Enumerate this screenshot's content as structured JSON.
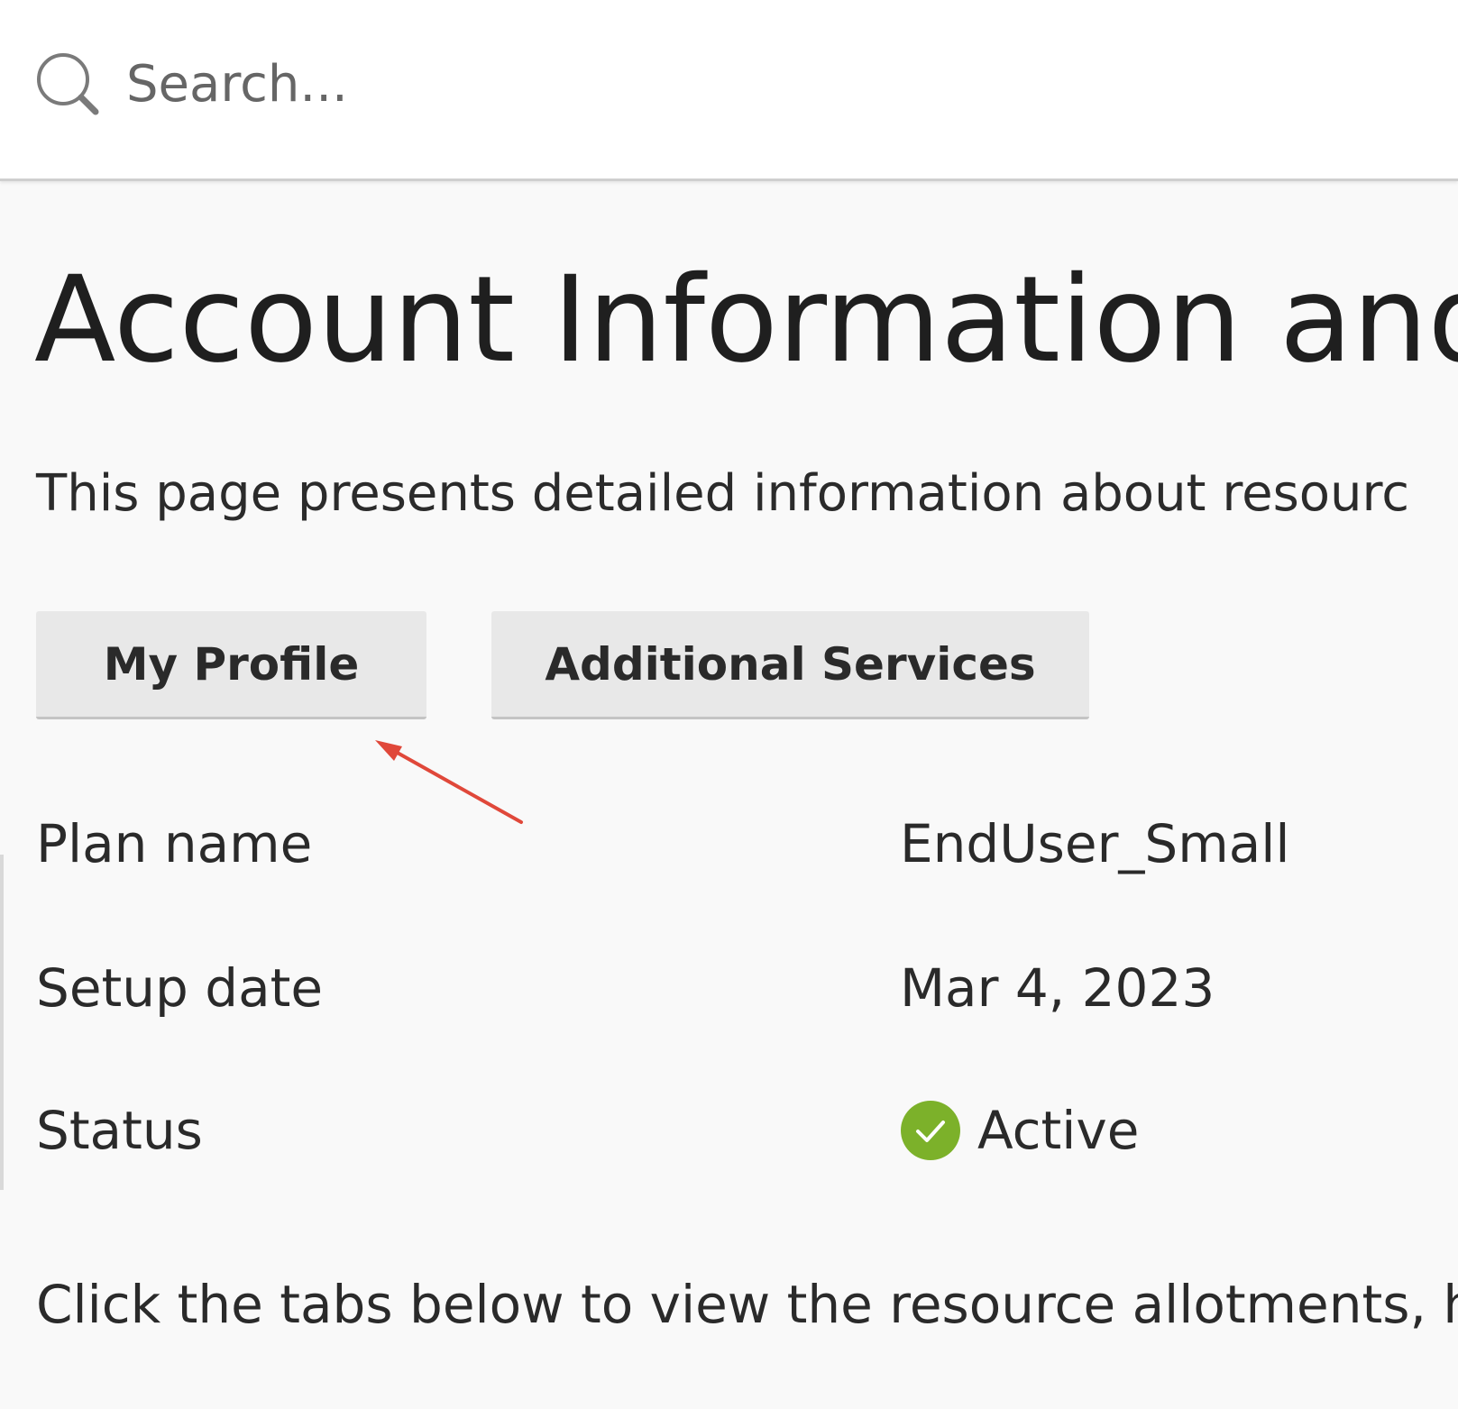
{
  "search": {
    "placeholder": "Search...",
    "value": ""
  },
  "page": {
    "title": "Account Information and",
    "intro": "This page presents detailed information about resourc"
  },
  "tabs": [
    {
      "label": "My Profile"
    },
    {
      "label": "Additional Services"
    }
  ],
  "info": {
    "plan": {
      "label": "Plan name",
      "value": "EndUser_Small"
    },
    "setup": {
      "label": "Setup date",
      "value": "Mar 4, 2023"
    },
    "status": {
      "label": "Status",
      "value": "Active"
    }
  },
  "footer": {
    "text": "Click the tabs below to view the resource allotments, ho"
  },
  "colors": {
    "status_active": "#7cb12a",
    "annotation_arrow": "#e0483a"
  },
  "icons": {
    "search": "search-icon",
    "status": "check-circle-icon"
  }
}
